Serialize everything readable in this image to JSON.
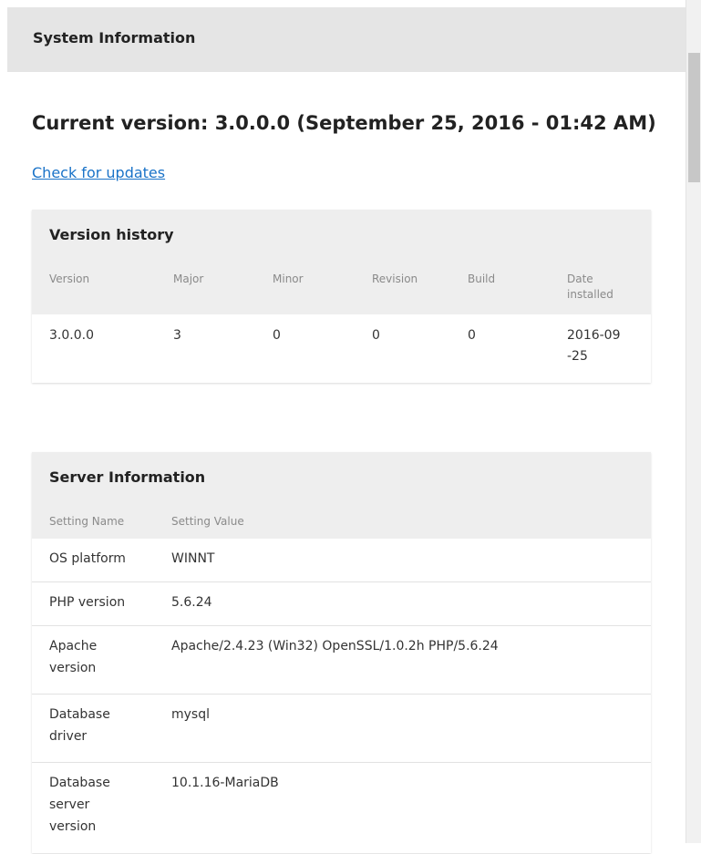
{
  "header": {
    "title": "System Information"
  },
  "main": {
    "current_version": "Current version: 3.0.0.0 (September 25, 2016 - 01:42 AM)",
    "check_updates_label": "Check for updates"
  },
  "version_history": {
    "title": "Version history",
    "columns": [
      "Version",
      "Major",
      "Minor",
      "Revision",
      "Build",
      "Date installed"
    ],
    "rows": [
      [
        "3.0.0.0",
        "3",
        "0",
        "0",
        "0",
        "2016-09-25"
      ]
    ]
  },
  "server_information": {
    "title": "Server Information",
    "columns": [
      "Setting Name",
      "Setting Value"
    ],
    "rows": [
      [
        "OS platform",
        "WINNT"
      ],
      [
        "PHP version",
        "5.6.24"
      ],
      [
        "Apache version",
        "Apache/2.4.23 (Win32) OpenSSL/1.0.2h PHP/5.6.24"
      ],
      [
        "Database driver",
        "mysql"
      ],
      [
        "Database server version",
        "10.1.16-MariaDB"
      ]
    ]
  }
}
